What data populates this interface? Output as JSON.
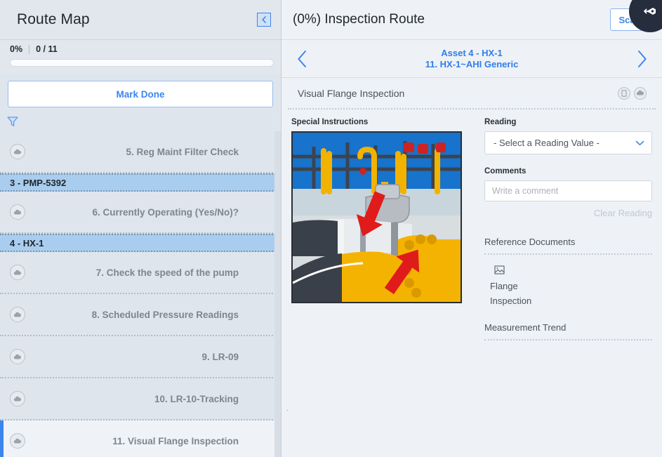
{
  "left_panel": {
    "title": "Route Map",
    "collapse_icon": "chevron-left-icon",
    "progress": {
      "percent": "0%",
      "count": "0 / 11",
      "value": 0
    },
    "mark_done_label": "Mark Done",
    "filter_icon": "filter-funnel-icon",
    "rows": [
      {
        "kind": "task",
        "label": "5. Reg Maint Filter Check",
        "icon": "cloud-icon",
        "selected": false
      },
      {
        "kind": "asset",
        "label": "3 - PMP-5392"
      },
      {
        "kind": "task",
        "label": "6. Currently Operating (Yes/No)?",
        "icon": "cloud-icon",
        "selected": false
      },
      {
        "kind": "asset",
        "label": "4 - HX-1"
      },
      {
        "kind": "task",
        "label": "7. Check the speed of the pump",
        "icon": "cloud-icon",
        "selected": false
      },
      {
        "kind": "task",
        "label": "8. Scheduled Pressure Readings",
        "icon": "cloud-icon",
        "selected": false
      },
      {
        "kind": "task",
        "label": "9. LR-09",
        "icon": "cloud-icon",
        "selected": false
      },
      {
        "kind": "task",
        "label": "10. LR-10-Tracking",
        "icon": "cloud-icon",
        "selected": false
      },
      {
        "kind": "task",
        "label": "11. Visual Flange Inspection",
        "icon": "cloud-icon",
        "selected": true
      }
    ]
  },
  "right_panel": {
    "title": "(0%) Inspection Route",
    "scan_label": "Scan",
    "exit_icon": "logout-icon",
    "nav": {
      "prev_icon": "chevron-left-icon",
      "next_icon": "chevron-right-icon",
      "line1": "Asset 4 - HX-1",
      "line2": "11. HX-1~AHI Generic"
    },
    "subheader": {
      "title": "Visual Flange Inspection",
      "icons": [
        "device-icon",
        "cloud-icon"
      ]
    },
    "special_instructions": {
      "label": "Special Instructions",
      "image_alt": "industrial-pipeline-flange-photo"
    },
    "reading": {
      "label": "Reading",
      "selected": "- Select a Reading Value -",
      "chevron_icon": "chevron-down-icon"
    },
    "comments": {
      "label": "Comments",
      "value": "",
      "placeholder": "Write a comment"
    },
    "clear_reading_label": "Clear Reading",
    "reference_documents": {
      "heading": "Reference Documents",
      "items": [
        {
          "icon": "broken-image-icon",
          "line1": "Flange",
          "line2": "Inspection"
        }
      ]
    },
    "measurement_trend": {
      "heading": "Measurement Trend"
    },
    "stray_mark": "."
  },
  "colors": {
    "accent_blue": "#3b86ec",
    "link_blue": "#2f7dea",
    "asset_row_blue": "#a9cdee",
    "panel_bg": "#dfe5ec",
    "right_bg": "#eef2f6",
    "fab_dark": "#262d3d",
    "muted_text": "#7d858f"
  }
}
